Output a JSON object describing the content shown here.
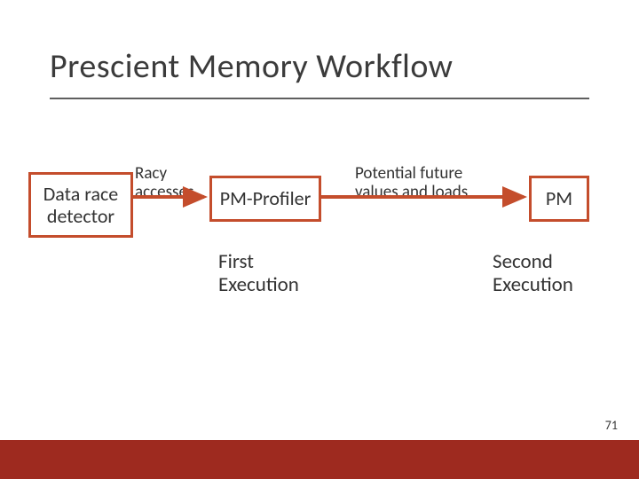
{
  "title": "Prescient Memory Workflow",
  "boxes": {
    "drd": "Data race detector",
    "pmp": "PM-Profiler",
    "pm": "PM"
  },
  "arrow_labels": {
    "racy": "Racy accesses",
    "pot": "Potential future values and loads"
  },
  "execs": {
    "first": "First Execution",
    "second": "Second Execution"
  },
  "page_number": "71",
  "colors": {
    "accent": "#c44d2c",
    "bottom_bar": "#9e2a1f"
  }
}
